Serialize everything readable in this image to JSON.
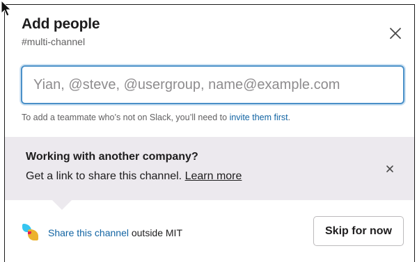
{
  "dialog": {
    "title": "Add people",
    "channel_name": "#multi-channel",
    "close_icon": "close-icon"
  },
  "search": {
    "value": "",
    "placeholder": "Yian, @steve, @usergroup, name@example.com"
  },
  "hint": {
    "text": "To add a teammate who’s not on Slack, you’ll need to ",
    "link": "invite them first",
    "suffix": "."
  },
  "banner": {
    "title": "Working with another company?",
    "body": "Get a link to share this channel. ",
    "learn_more": "Learn more",
    "close_icon": "close-icon"
  },
  "footer": {
    "share_link": "Share this channel",
    "share_suffix": " outside MIT",
    "skip_label": "Skip for now",
    "icon": "shared-channel-icon"
  },
  "colors": {
    "accent": "#1264a3",
    "focus_border": "#4a90c8",
    "banner_bg": "#ece9ee"
  }
}
